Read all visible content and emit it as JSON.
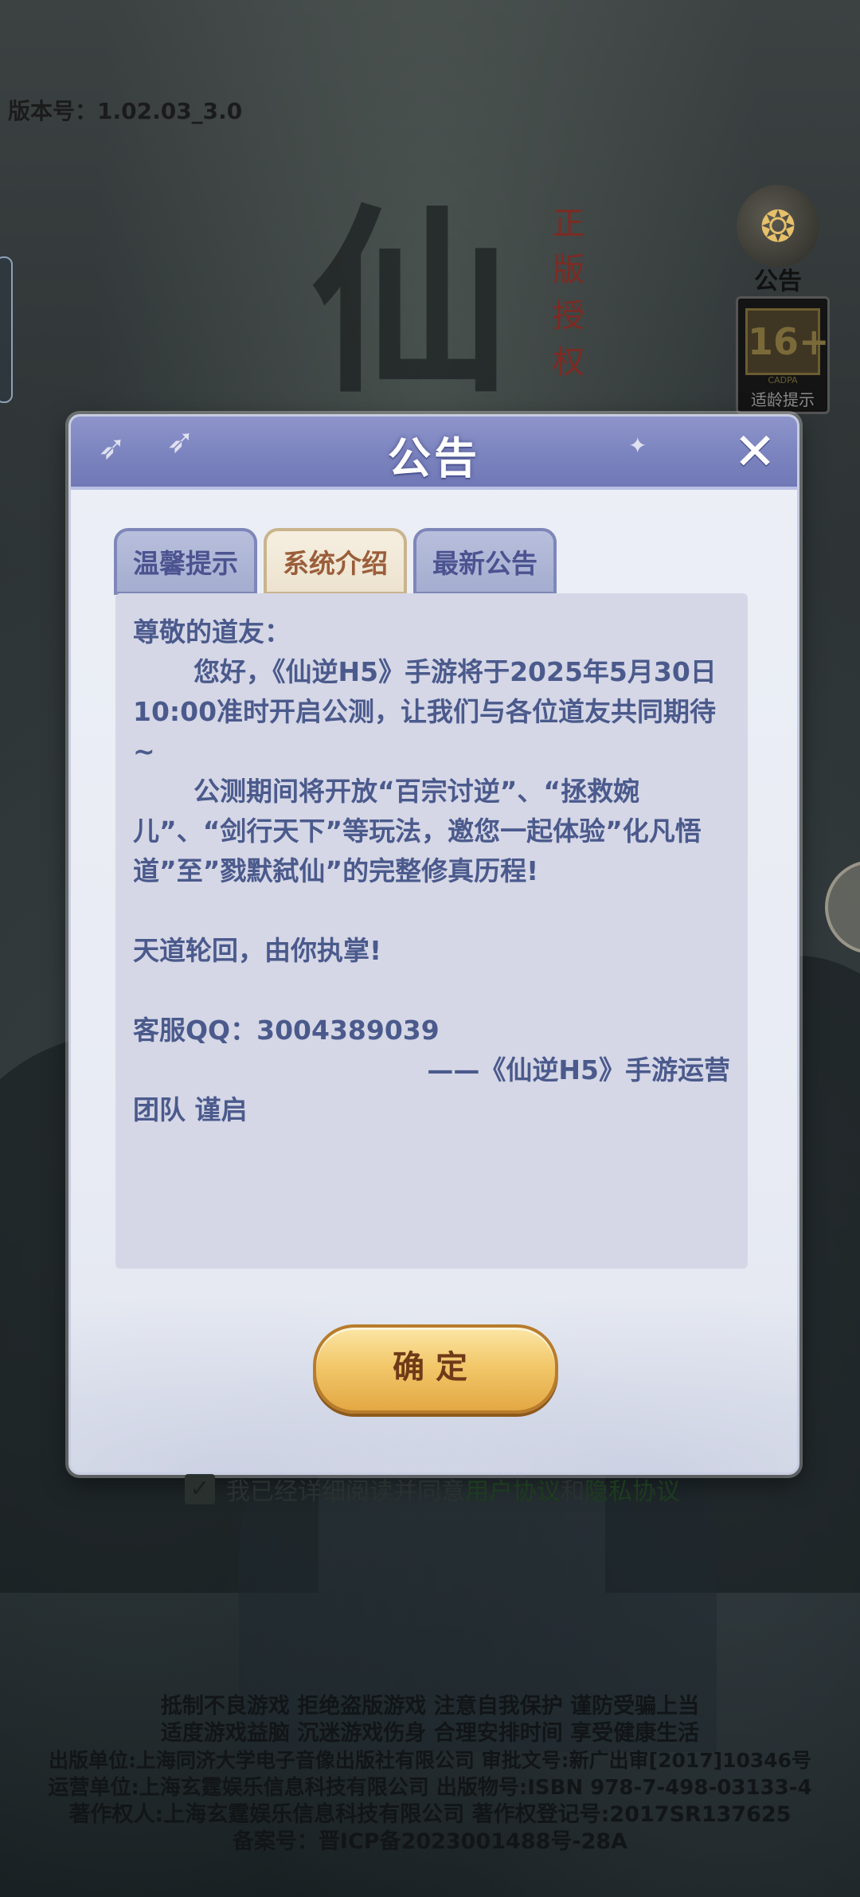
{
  "version_text": "版本号：1.02.03_3.0",
  "background": {
    "big_glyph": "仙",
    "vertical_text": "正版授权"
  },
  "side_buttons": {
    "notice_label": "公告",
    "age_badge_value": "16+",
    "age_badge_org": "CADPA",
    "age_badge_tip": "适龄提示"
  },
  "dialog": {
    "title": "公告",
    "tabs": [
      {
        "label": "温馨提示",
        "active": false
      },
      {
        "label": "系统介绍",
        "active": true
      },
      {
        "label": "最新公告",
        "active": false
      }
    ],
    "content": {
      "greeting": "尊敬的道友：",
      "para1": "您好，《仙逆H5》手游将于2025年5月30日10:00准时开启公测，让我们与各位道友共同期待~",
      "para2": "公测期间将开放“百宗讨逆”、“拯救婉儿”、“剑行天下”等玩法，邀您一起体验”化凡悟道”至”戮默弑仙”的完整修真历程!",
      "slogan": "天道轮回，由你执掌!",
      "qq": "客服QQ：3004389039",
      "sign1": "——《仙逆H5》手游运营",
      "sign2": "团队 谨启"
    },
    "confirm_label": "确定"
  },
  "agreement": {
    "prefix": "我已经详细阅读并同意",
    "user_agreement": "用户协议",
    "and": "和",
    "privacy_agreement": "隐私协议"
  },
  "footer": {
    "lines": [
      "抵制不良游戏 拒绝盗版游戏 注意自我保护 谨防受骗上当",
      "适度游戏益脑 沉迷游戏伤身 合理安排时间 享受健康生活",
      "出版单位:上海同济大学电子音像出版社有限公司 审批文号:新广出审[2017]10346号",
      "运营单位:上海玄霆娱乐信息科技有限公司 出版物号:ISBN 978-7-498-03133-4",
      "著作权人:上海玄霆娱乐信息科技有限公司 著作权登记号:2017SR137625",
      "备案号：晋ICP备2023001488号-28A"
    ]
  }
}
